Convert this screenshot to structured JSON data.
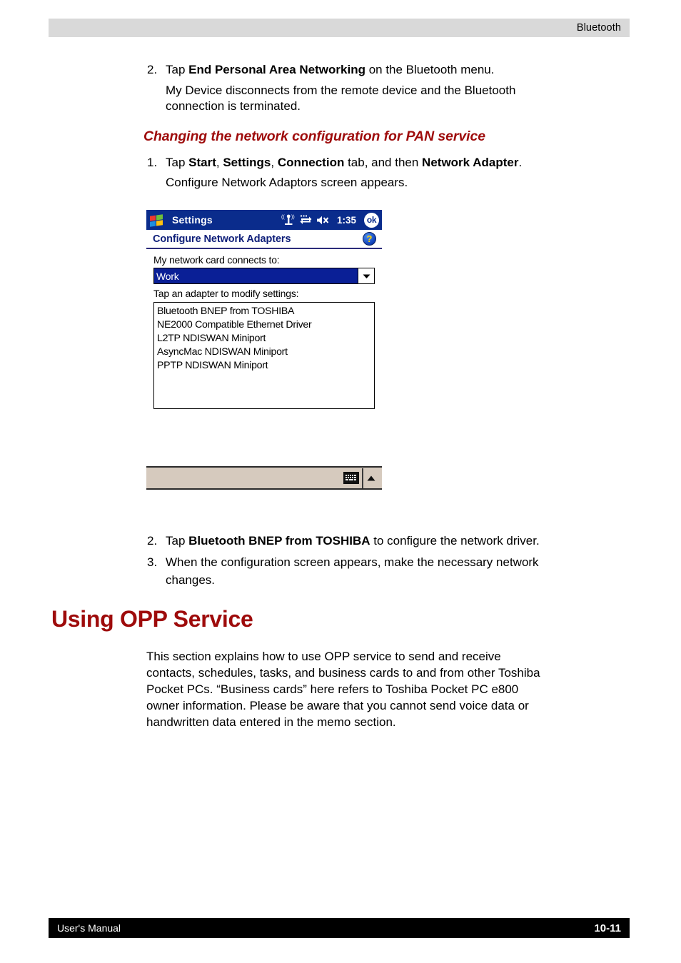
{
  "header": {
    "chapter_title": "Bluetooth",
    "band_color": "#d9d9d9"
  },
  "footer": {
    "manual_label": "User's Manual",
    "page_number": "10-11",
    "band_color": "#000000"
  },
  "theme": {
    "heading_red": "#9e0b0b",
    "ppc_titlebar_blue": "#0a2c8c",
    "ppc_select_blue": "#0a1f96",
    "ppc_taskbar_beige": "#d6cabe",
    "ppc_subtitle_blue": "#10207a"
  },
  "content": {
    "step_2_top": {
      "marker": "2.",
      "pre": "Tap ",
      "bold": "End Personal Area Networking",
      "post": " on the Bluetooth menu."
    },
    "step_2_top_result_line1": "My Device disconnects from the remote device and the Bluetooth",
    "step_2_top_result_line2": "connection is terminated.",
    "sub_heading": "Changing the network configuration for PAN service",
    "step_1": {
      "marker": "1.",
      "p1": "Tap ",
      "b1": "Start",
      "p2": ", ",
      "b2": "Settings",
      "p3": ", ",
      "b3": "Connection",
      "p4": " tab, and then ",
      "b4": "Network Adapter",
      "p5": "."
    },
    "step_1_result": "Configure Network Adaptors screen appears.",
    "step_2_bottom": {
      "marker": "2.",
      "pre": "Tap ",
      "bold": "Bluetooth BNEP from TOSHIBA",
      "post": " to configure the network driver."
    },
    "step_3_bottom": {
      "marker": "3.",
      "line1": "When the configuration screen appears, make the necessary network",
      "line2": "changes."
    },
    "section_heading": "Using OPP Service",
    "section_paragraph_lines": [
      "This section explains how to use OPP service to send and receive",
      "contacts, schedules, tasks, and business cards to and from other Toshiba",
      "Pocket PCs. “Business cards” here refers to Toshiba Pocket PC e800",
      "owner information. Please be aware that you cannot send voice data or",
      "handwritten data entered in the memo section."
    ]
  },
  "screenshot": {
    "titlebar": {
      "start_icon": "windows-flag-icon",
      "app_title": "Settings",
      "tray": [
        {
          "icon": "wireless-signal-icon"
        },
        {
          "icon": "network-connectivity-icon"
        },
        {
          "icon": "volume-muted-icon"
        }
      ],
      "clock": "1:35",
      "ok_label": "ok"
    },
    "subtitle": {
      "text": "Configure Network Adapters",
      "help_glyph": "?"
    },
    "combo": {
      "label": "My network card connects to:",
      "value": "Work",
      "options": [
        "Work"
      ]
    },
    "listbox": {
      "label": "Tap an adapter to modify settings:",
      "items": [
        "Bluetooth BNEP from TOSHIBA",
        "NE2000 Compatible Ethernet Driver",
        "L2TP NDISWAN Miniport",
        "AsyncMac NDISWAN Miniport",
        "PPTP NDISWAN Miniport"
      ]
    },
    "taskbar": {
      "sip_icon": "keyboard-icon",
      "sip_arrow": "triangle-up-icon"
    }
  }
}
